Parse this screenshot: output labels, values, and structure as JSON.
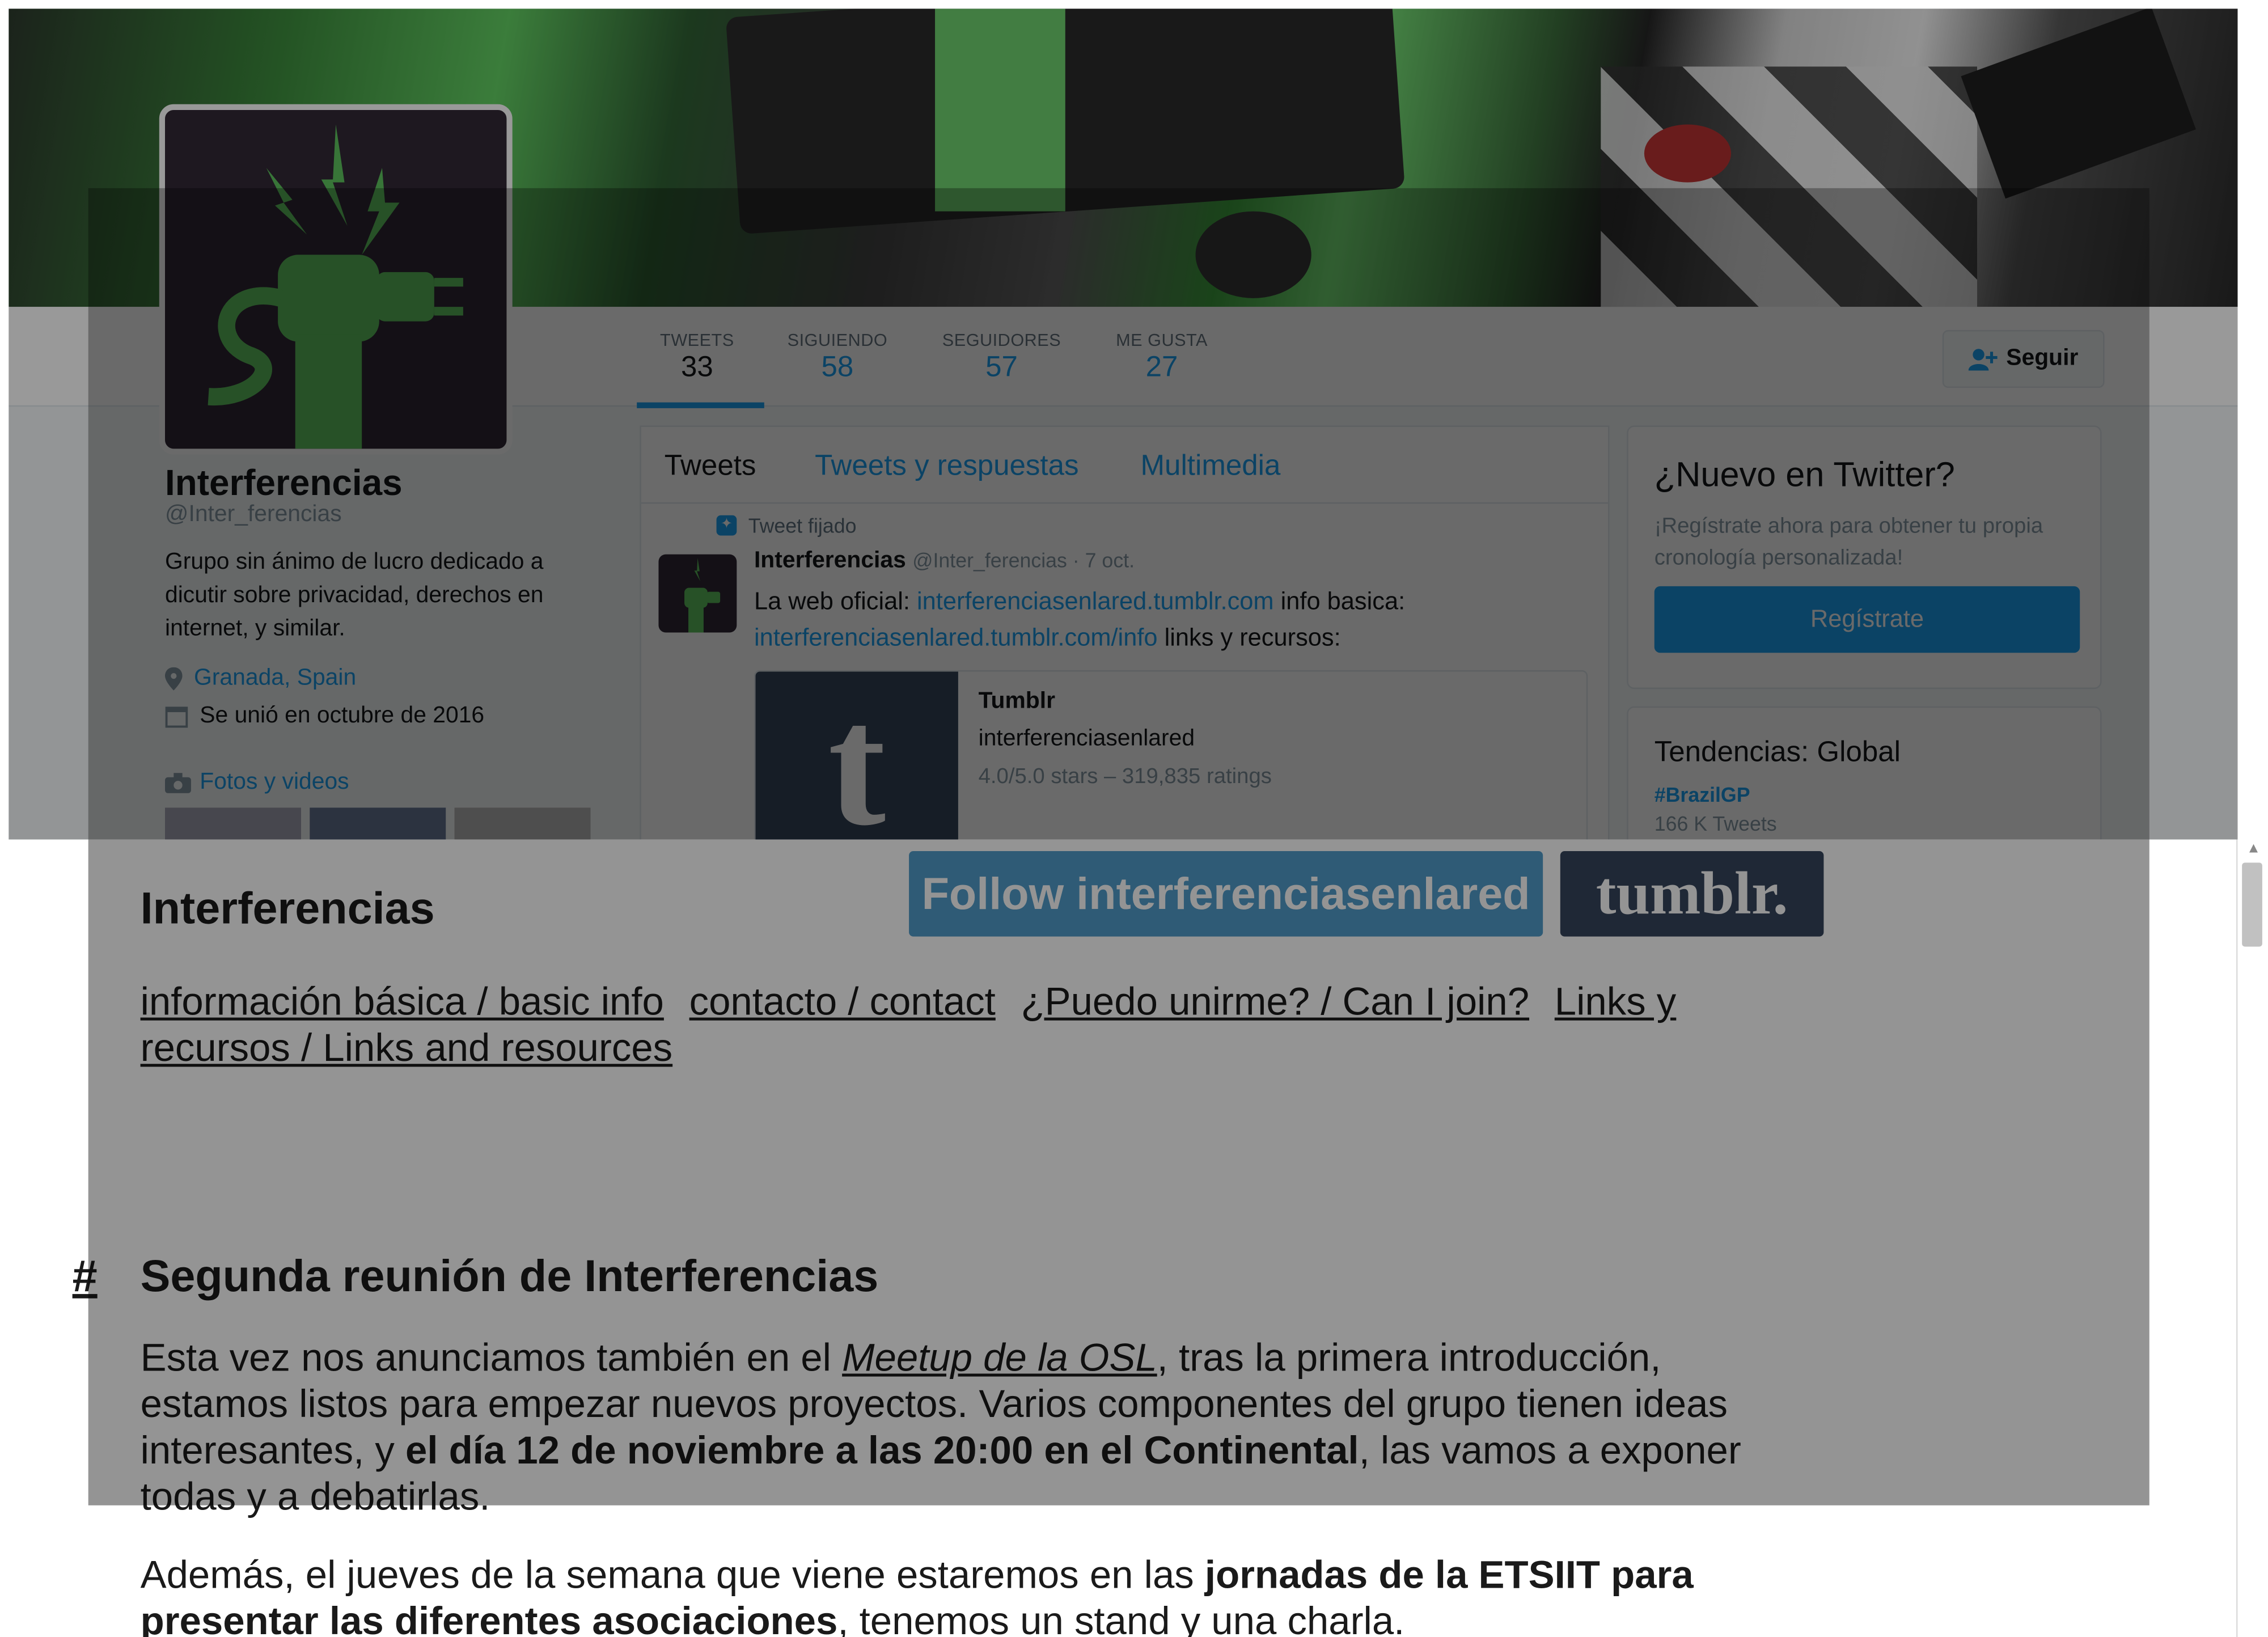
{
  "twitter": {
    "profile": {
      "name": "Interferencias",
      "handle": "@Inter_ferencias",
      "bio": "Grupo sin ánimo de lucro dedicado a dicutir sobre privacidad, derechos en internet, y similar.",
      "location": "Granada, Spain",
      "joined": "Se unió en octubre de 2016",
      "photos_label": "Fotos y videos"
    },
    "stats": [
      {
        "label": "TWEETS",
        "value": "33"
      },
      {
        "label": "SIGUIENDO",
        "value": "58"
      },
      {
        "label": "SEGUIDORES",
        "value": "57"
      },
      {
        "label": "ME GUSTA",
        "value": "27"
      }
    ],
    "follow_label": "Seguir",
    "timeline_tabs": [
      "Tweets",
      "Tweets y respuestas",
      "Multimedia"
    ],
    "tweet": {
      "pinned_label": "Tweet fijado",
      "author": "Interferencias",
      "meta": "@Inter_ferencias · 7 oct.",
      "text_1": "La web oficial: ",
      "link_1": "interferenciasenlared.tumblr.com",
      "text_2": "  info basica: ",
      "link_2": "interferenciasenlared.tumblr.com/info",
      "text_3": " links y recursos:",
      "card_title": "Tumblr",
      "card_sub": "interferenciasenlared",
      "card_rating": "4.0/5.0 stars – 319,835 ratings",
      "card_glyph": "t"
    },
    "signup": {
      "title": "¿Nuevo en Twitter?",
      "subtitle": "¡Regístrate ahora para obtener tu propia cronología personalizada!",
      "button": "Regístrate"
    },
    "trends": {
      "title": "Tendencias: Global",
      "tag": "#BrazilGP",
      "count": "166 K Tweets"
    }
  },
  "tumblr": {
    "blog_title": "Interferencias",
    "follow_button": "Follow interferenciasenlared",
    "logo": "tumblr.",
    "nav": [
      "información básica / basic info",
      "contacto / contact",
      "¿Puedo unirme? / Can I join?",
      "Links y recursos / Links and resources"
    ],
    "post": {
      "anchor": "#",
      "title": "Segunda reunión de Interferencias",
      "p1_a": "Esta vez nos anunciamos también en el ",
      "p1_link": "Meetup de la OSL",
      "p1_b": ", tras la primera introducción, estamos listos para empezar nuevos proyectos. Varios componentes del grupo tienen ideas interesantes, y ",
      "p1_bold": "el día 12 de noviembre a las 20:00 en el Continental",
      "p1_c": ", las vamos a exponer todas y a debatirlas.",
      "p2_a": "Además, el jueves de la semana que viene estaremos en las ",
      "p2_bold": "jornadas de la ETSIIT para presentar las diferentes asociaciones",
      "p2_b": ", tenemos un stand y una charla."
    }
  },
  "colors": {
    "twitter_blue": "#1da1f2",
    "tumblr_follow": "#529ecc",
    "tumblr_navy": "#36465d",
    "logo_green": "#5ec45e"
  },
  "icons": [
    "location-pin-icon",
    "calendar-icon",
    "camera-icon",
    "add-user-icon",
    "pin-icon",
    "scroll-up-arrow-icon"
  ]
}
